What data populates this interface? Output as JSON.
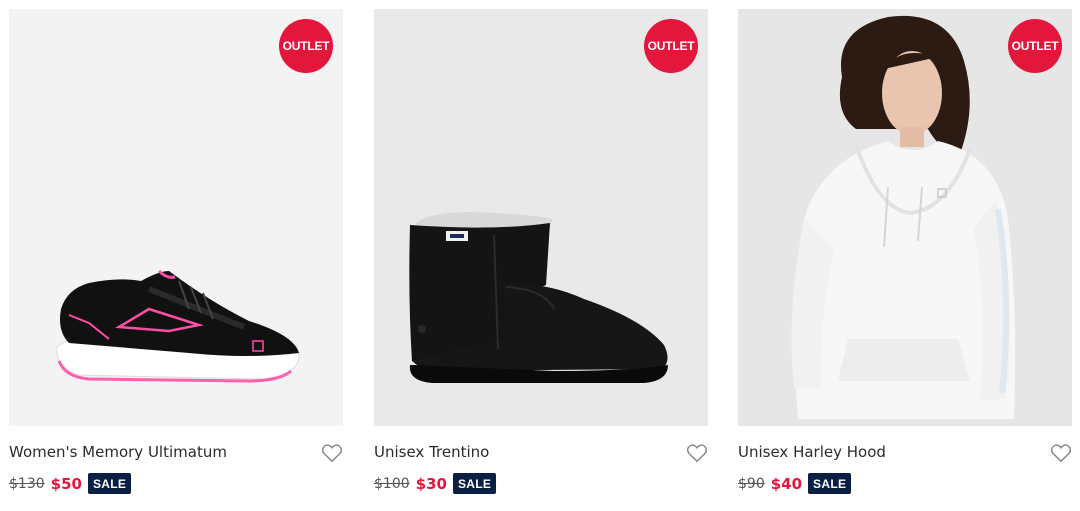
{
  "products": [
    {
      "badge": "OUTLET",
      "name": "Women's Memory Ultimatum",
      "old_price": "$130",
      "new_price": "$50",
      "sale_label": "SALE",
      "image": "pink-black-running-shoe"
    },
    {
      "badge": "OUTLET",
      "name": "Unisex Trentino",
      "old_price": "$100",
      "new_price": "$30",
      "sale_label": "SALE",
      "image": "black-suede-ankle-boot"
    },
    {
      "badge": "OUTLET",
      "name": "Unisex Harley Hood",
      "old_price": "$90",
      "new_price": "$40",
      "sale_label": "SALE",
      "image": "white-hoodie-model"
    }
  ],
  "icons": {
    "wishlist": "heart-outline-icon"
  },
  "colors": {
    "badge": "#e3163b",
    "sale_price": "#e3163b",
    "sale_tag": "#0b1f45"
  }
}
